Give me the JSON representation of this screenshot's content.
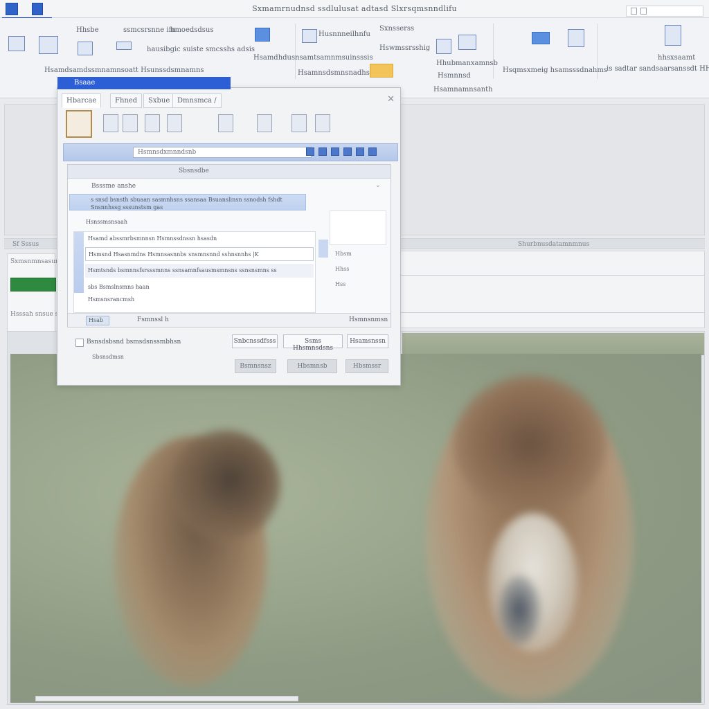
{
  "window": {
    "title": "Sxmamrnudnsd ssdlulusat adtasd  Slxrsqmsnndlifu"
  },
  "ribbon": {
    "labels": [
      "Hhsbe",
      "ssmcsrsnne  ifu",
      "hmoedsdsus",
      "Husnnneilhnfu",
      "Sxnsserss",
      "Hswmssrsshig",
      "hausibgic  suiste  smcsshs adsis",
      "Hsamdhdusnsamtsamnmsuinsssis",
      "Hsamdsamdssmnamnsoatt  Hsunssdsmnamns",
      "Hsamnsdsmnsnadhs",
      "Hhubmanxamnsb",
      "Hsmnnsd",
      "Hsqmsxmeig  hsamsssdnahms",
      "Hsamnamnsanth",
      "is  sadtar  sandsaarsanssdt  HHdtgi",
      "hhsxsaamt"
    ]
  },
  "workspace": {
    "split_left": "Sf  Sssus",
    "split_right": "Shurbnusdatamnmnus",
    "left_panel_label_1": "Sxmsnmnsasun",
    "left_panel_label_2": "Hsssah  snsue  ss"
  },
  "dialog": {
    "title": "Bsaae",
    "close": "✕",
    "tabs": [
      "Hbarcae",
      "Fhned",
      "Sxbue",
      "Dmnsmca  /"
    ],
    "search_value": "Hsmnsdxmnndsnb",
    "inner_header": "Sbsnsdbe",
    "section_title": "Bsssme  anshe",
    "rows": [
      "s  snsd  bsnsth sbuaan  sasmnhsns ssansaa  Bsuanslinsn ssnodsh  fshdt",
      "Snsnnhssg  sssunstsm  gas"
    ],
    "group_label": "Hsnssmsnsaah",
    "list_header": "Hsamd  abssmrbsmnnsn    Hsmnssdnssn  hsasdn",
    "list_items": [
      "Hsmsnd  Hsasnmdns  Hsmnsasnnbs  snsmnsnnd  sshnsnnhs  |K",
      "Hsmtsnds  bsmnnsfsrsssmnns  ssnsamnfsausmsmnsns  ssnsnsmns  ss",
      "sbs  Bsmslnsmns  haan",
      "Hsmsnsrancmsh"
    ],
    "side_labels": [
      "Hbsm",
      "Hhss",
      "Hss"
    ],
    "footer_btn": "Hsab",
    "footer_center": "Fsmnssl  h",
    "footer_right": "Hsmnsnmsn",
    "checkbox_label": "Bsnsdsbsnd  bsmsdsnssmbhsn",
    "checkbox_sub": "Sbsnsdmsn",
    "buttons_row1": [
      "Snbcnssdfsss",
      "Ssms  Hhsmnsdsns",
      "Hsamsnssn"
    ],
    "buttons_row2": [
      "Bsmnsnsz",
      "Hbsmnsb",
      "Hbsmssr"
    ]
  },
  "colors": {
    "accent": "#2c5fd6",
    "ribbon_tab": "#1f4fd1",
    "green_button": "#2e8a3e",
    "photo_background": "#9aa68d"
  }
}
